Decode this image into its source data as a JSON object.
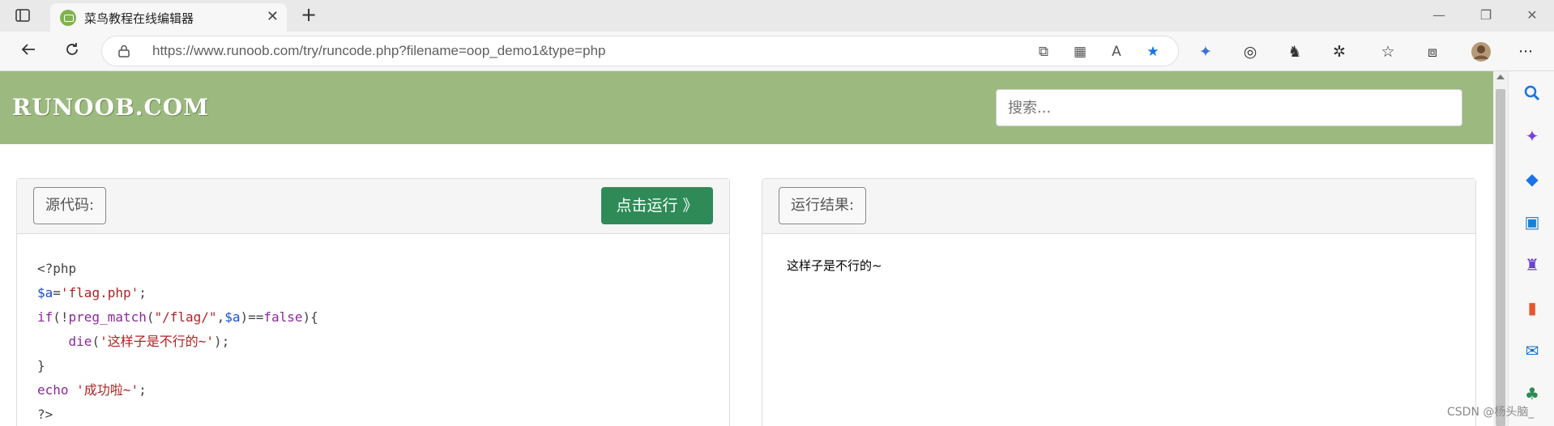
{
  "browser": {
    "tab_title": "菜鸟教程在线编辑器",
    "tab_close": "✕",
    "new_tab": "+",
    "url_domain": "https://www.runoob.com",
    "url_path": "/try/runcode.php?filename=oop_demo1&type=php",
    "window_controls": {
      "minimize": "—",
      "restore": "❐",
      "close": "✕"
    },
    "toolbar_more": "···"
  },
  "site": {
    "logo": "RUNOOB.COM",
    "search_placeholder": "搜索..."
  },
  "editor": {
    "source_label": "源代码:",
    "run_button": "点击运行 》",
    "code_lines": [
      "<?php",
      "$a='flag.php';",
      "if(!preg_match(\"/flag/\",$a)==false){",
      "    die('这样子是不行的~');",
      "}",
      "echo '成功啦~';",
      "?>"
    ]
  },
  "result": {
    "label": "运行结果:",
    "output": "这样子是不行的~"
  },
  "watermark": "CSDN @杨头脑_",
  "colors": {
    "header_green": "#9cba7f",
    "run_button": "#2e8b57",
    "edge_blue": "#1a73e8"
  }
}
